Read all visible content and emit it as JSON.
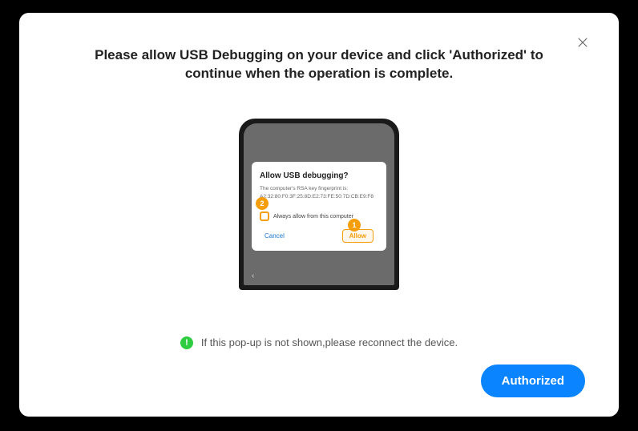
{
  "modal": {
    "title": "Please allow USB Debugging on your device and click 'Authorized' to continue when the operation is complete."
  },
  "phone_dialog": {
    "title": "Allow USB debugging?",
    "fingerprint_label": "The computer's RSA key fingerprint is:",
    "fingerprint_value": "A2:32:80:F0:3F:25:8D:E2:73:FE:50:7D:CB:E9:F8",
    "checkbox_label": "Always allow from this computer",
    "cancel_label": "Cancel",
    "allow_label": "Allow"
  },
  "markers": {
    "one": "1",
    "two": "2"
  },
  "hint": {
    "icon_char": "!",
    "text": "If this pop-up is not shown,please reconnect the device."
  },
  "authorized_button": "Authorized"
}
